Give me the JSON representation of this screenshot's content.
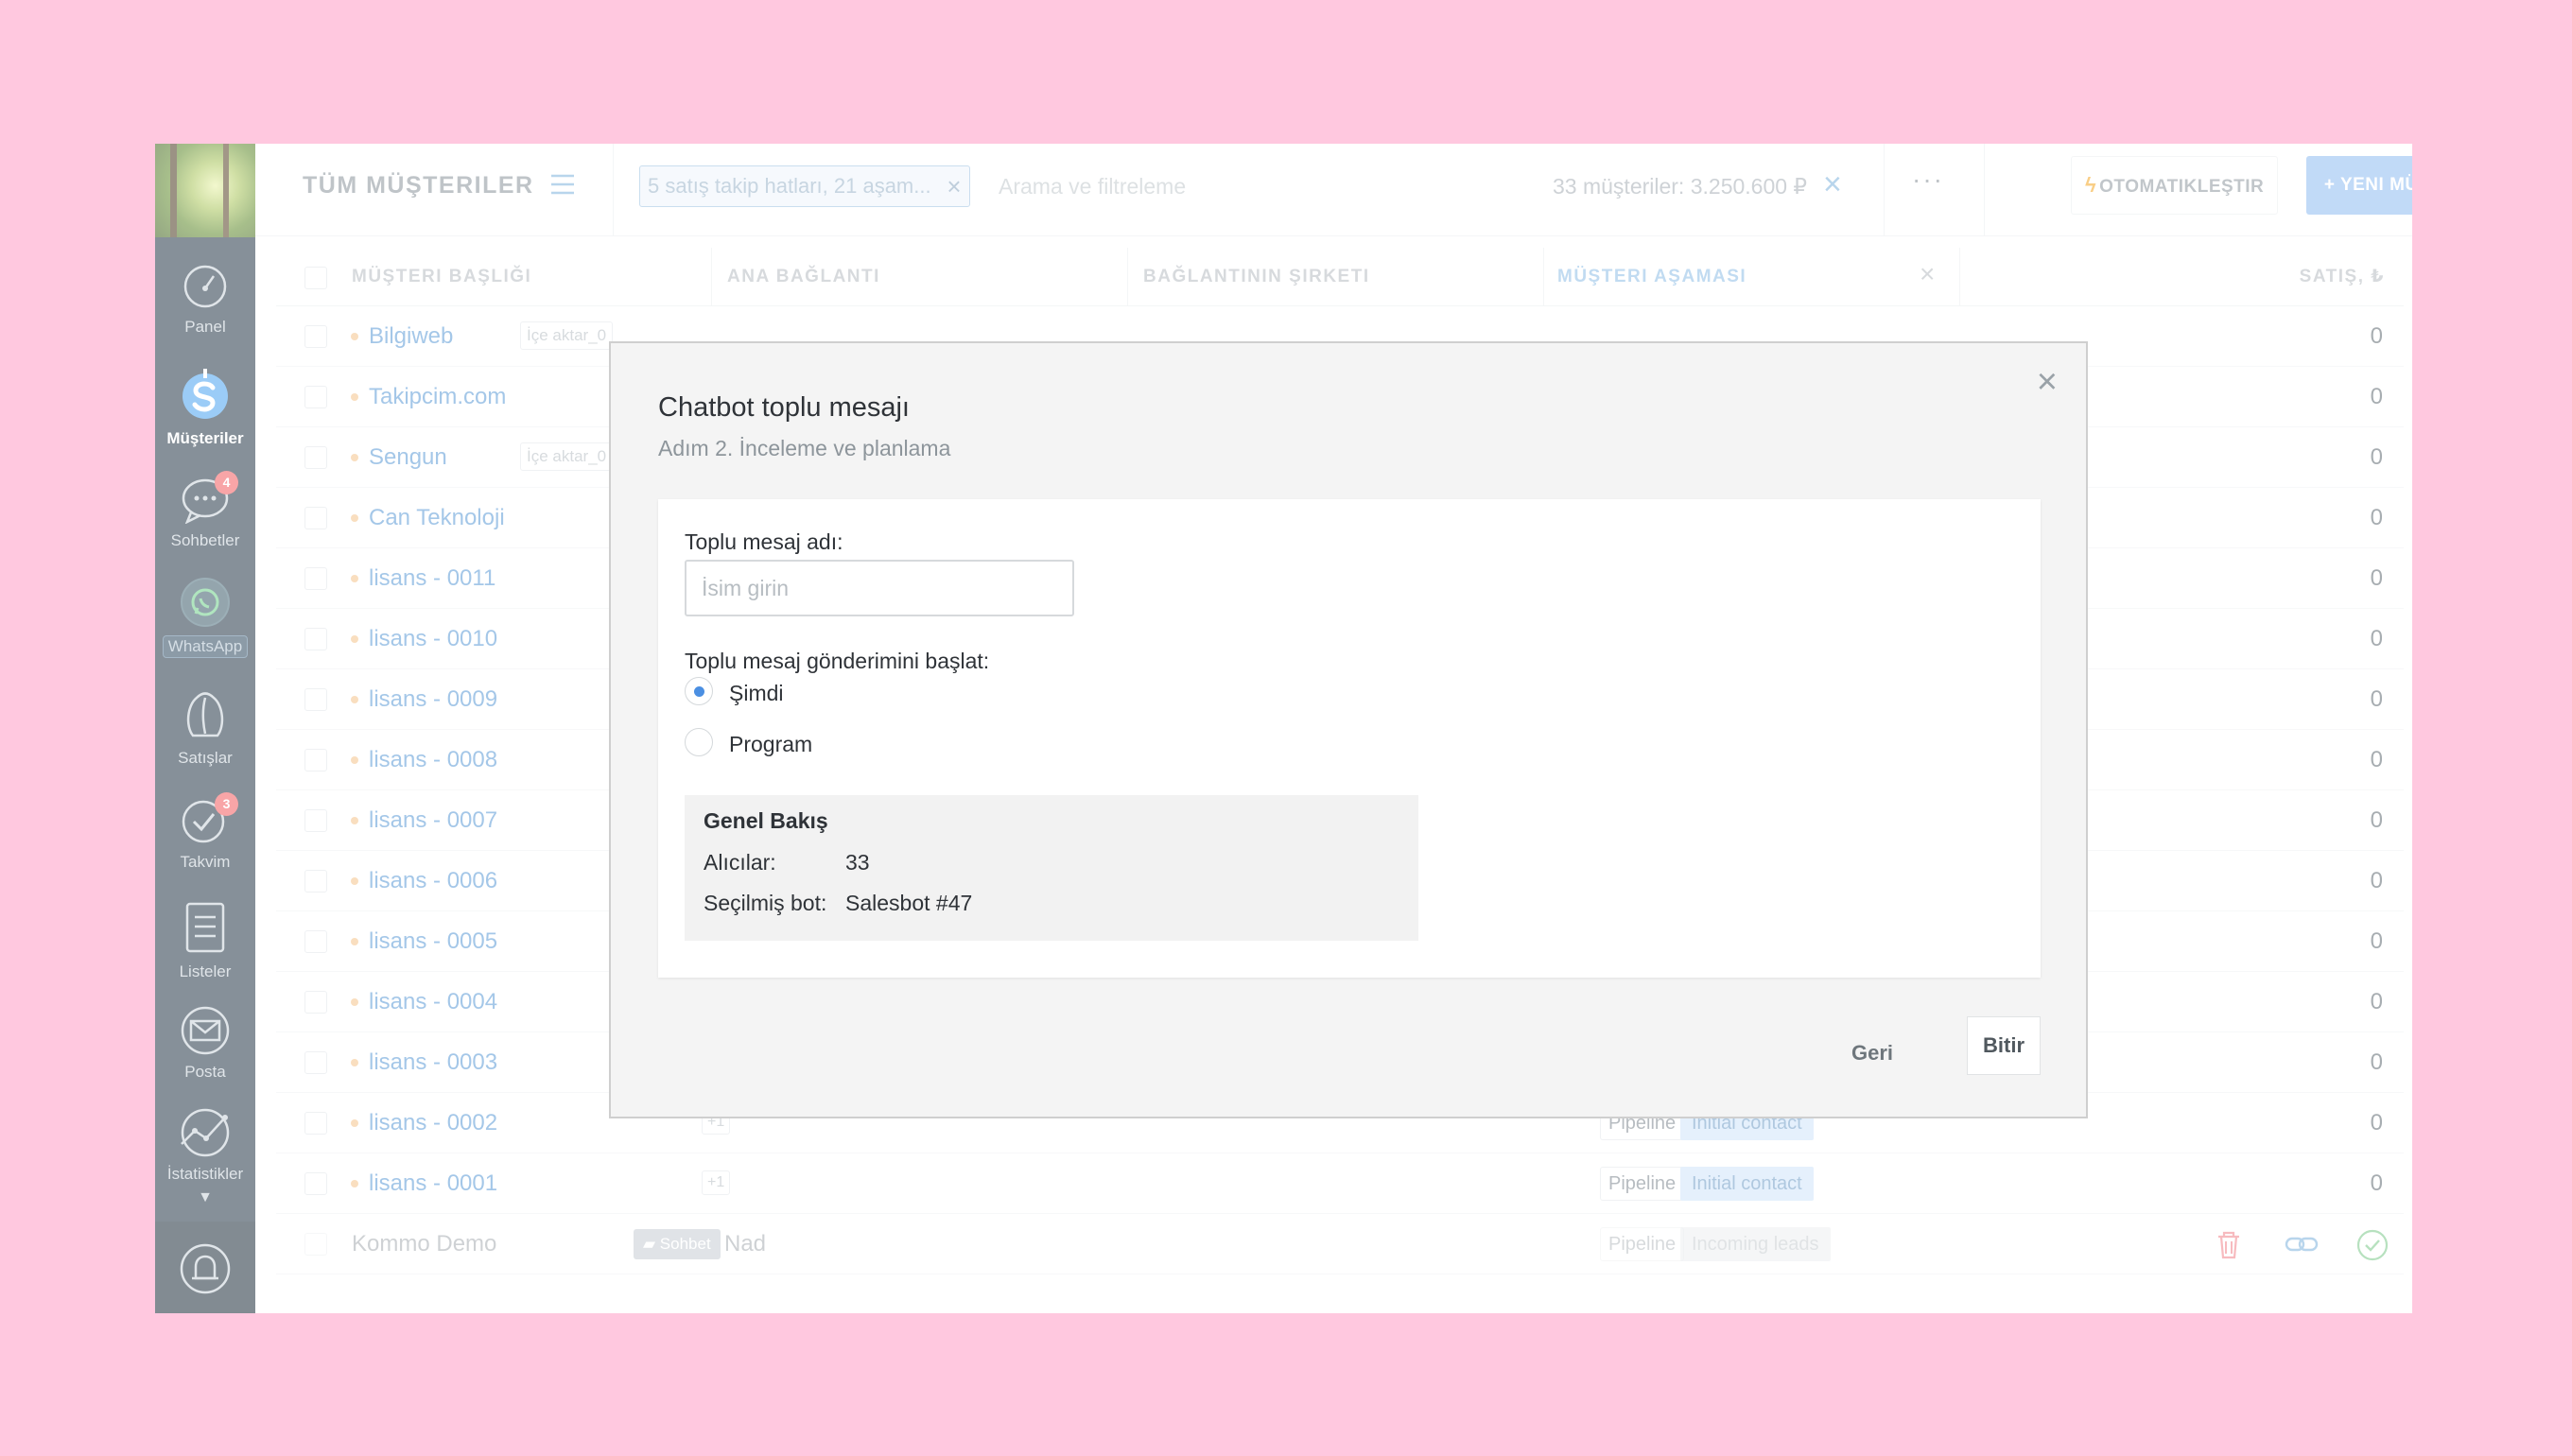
{
  "sidebar": {
    "items": [
      {
        "label": "Panel"
      },
      {
        "label": "Müşteriler"
      },
      {
        "label": "Sohbetler",
        "badge": "4"
      },
      {
        "label": "WhatsApp"
      },
      {
        "label": "Satışlar"
      },
      {
        "label": "Takvim",
        "badge": "3"
      },
      {
        "label": "Listeler"
      },
      {
        "label": "Posta"
      },
      {
        "label": "İstatistikler"
      }
    ]
  },
  "header": {
    "title": "TÜM MÜŞTERILER",
    "filter_chip": "5 satış takip hatları, 21 aşam...",
    "search_placeholder": "Arama ve filtreleme",
    "count_text": "33 müşteriler: 3.250.600 ₽",
    "automate_label": "OTOMATIKLEŞTIR",
    "new_button_label": "+ YENI MÜŞTERI"
  },
  "table": {
    "columns": [
      "MÜŞTERI BAŞLIĞI",
      "ANA BAĞLANTI",
      "BAĞLANTININ ŞIRKETI",
      "MÜŞTERI AŞAMASI",
      "SATIŞ, ₺"
    ],
    "rows": [
      {
        "name": "Bilgiweb",
        "tag": "İçe aktar_0",
        "sum": "0"
      },
      {
        "name": "Takipcim.com",
        "sum": "0"
      },
      {
        "name": "Sengun",
        "tag": "İçe aktar_0",
        "sum": "0"
      },
      {
        "name": "Can Teknoloji",
        "sum": "0"
      },
      {
        "name": "lisans - 0011",
        "sum": "0"
      },
      {
        "name": "lisans - 0010",
        "sum": "0"
      },
      {
        "name": "lisans - 0009",
        "sum": "0"
      },
      {
        "name": "lisans - 0008",
        "sum": "0"
      },
      {
        "name": "lisans - 0007",
        "sum": "0"
      },
      {
        "name": "lisans - 0006",
        "sum": "0"
      },
      {
        "name": "lisans - 0005",
        "sum": "0"
      },
      {
        "name": "lisans - 0004",
        "sum": "0"
      },
      {
        "name": "lisans - 0003",
        "sum": "0"
      },
      {
        "name": "lisans - 0002",
        "plus": "+1",
        "pipeline": "Pipeline",
        "stage": "Initial contact",
        "sum": "0"
      },
      {
        "name": "lisans - 0001",
        "plus": "+1",
        "pipeline": "Pipeline",
        "stage": "Initial contact",
        "sum": "0"
      }
    ],
    "demo_row": {
      "name": "Kommo Demo",
      "chat": "Sohbet",
      "contact": "Nad",
      "pipeline": "Pipeline",
      "stage": "Incoming leads"
    }
  },
  "modal": {
    "title": "Chatbot toplu mesajı",
    "subtitle": "Adım 2. İnceleme ve planlama",
    "name_label": "Toplu mesaj adı:",
    "name_placeholder": "İsim girin",
    "start_label": "Toplu mesaj gönderimini başlat:",
    "option_now": "Şimdi",
    "option_schedule": "Program",
    "overview_title": "Genel Bakış",
    "recipients_key": "Alıcılar:",
    "recipients_value": "33",
    "bot_key": "Seçilmiş bot:",
    "bot_value": "Salesbot #47",
    "back_label": "Geri",
    "finish_label": "Bitir"
  },
  "colors": {
    "accent": "#4b8fe2",
    "sidebar": "#233645",
    "background": "#ffc8df",
    "badge": "#f35b5f"
  }
}
